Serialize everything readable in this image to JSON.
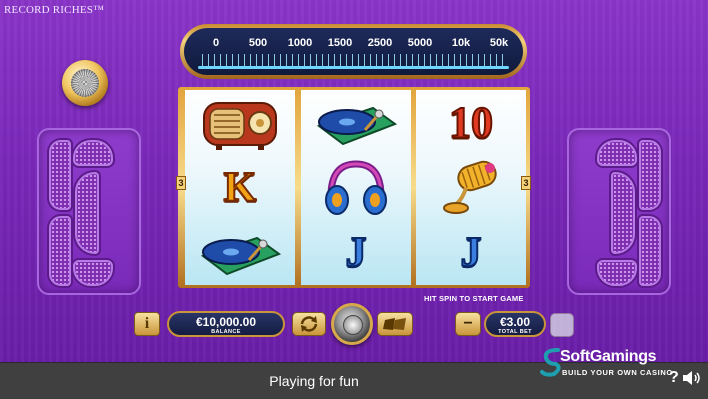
{
  "game": {
    "title": "RECORD RICHES™"
  },
  "dial": {
    "labels": [
      "0",
      "500",
      "1000",
      "1500",
      "2500",
      "5000",
      "10k",
      "50k"
    ]
  },
  "reels": {
    "lines_left": "3",
    "lines_right": "3",
    "reel1": [
      "radio-icon",
      "K",
      "turntable-icon"
    ],
    "reel2": [
      "turntable-icon",
      "headphones-icon",
      "J"
    ],
    "reel3": [
      "10",
      "microphone-icon",
      "J"
    ],
    "hint": "HIT SPIN TO START GAME"
  },
  "controls": {
    "info_label": "i",
    "balance_value": "€10,000.00",
    "balance_label": "BALANCE",
    "minus_label": "−",
    "bet_value": "€3.00",
    "bet_label": "TOTAL BET"
  },
  "footer": {
    "text": "Playing for fun",
    "help": "?",
    "brand_name": "SoftGamings",
    "brand_tagline": "BUILD YOUR OWN CASINO"
  },
  "colors": {
    "background": "#7a28b9",
    "footer": "#404040",
    "gold": "#c9943a",
    "pill": "#1e2a5a"
  }
}
